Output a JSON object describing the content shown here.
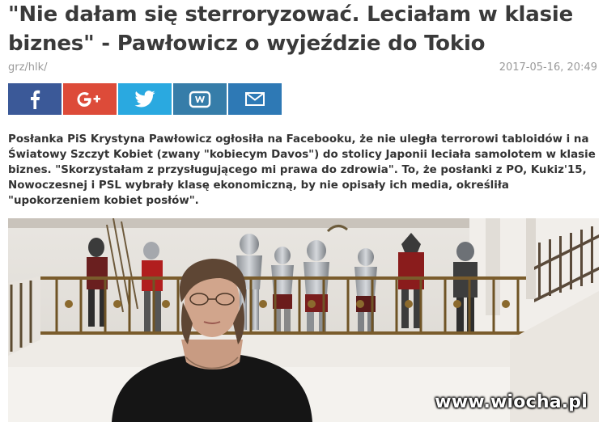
{
  "article": {
    "title": "\"Nie dałam się sterroryzować. Leciałam w klasie biznes\" - Pawłowicz o wyjeździe do Tokio",
    "author": "grz/hlk/",
    "date": "2017-05-16, 20:49",
    "lead": "Posłanka PiS Krystyna Pawłowicz ogłosiła na Facebooku, że nie uległa terrorowi tabloidów i na Światowy Szczyt Kobiet (zwany \"kobiecym Davos\") do stolicy Japonii leciała samolotem w klasie biznes. \"Skorzystałam z przysługującego mi prawa do zdrowia\". To, że posłanki z PO, Kukiz'15, Nowoczesnej i PSL wybrały klasę ekonomiczną, by nie opisały ich media, określiła \"upokorzeniem kobiet posłów\"."
  },
  "share": [
    {
      "name": "facebook-icon",
      "color": "#3b5998"
    },
    {
      "name": "google-plus-icon",
      "color": "#dd4b39"
    },
    {
      "name": "twitter-icon",
      "color": "#2aa9e0"
    },
    {
      "name": "wykop-icon",
      "color": "#367da9"
    },
    {
      "name": "email-icon",
      "color": "#2e79b5"
    }
  ],
  "watermark": "www.wiocha.pl"
}
